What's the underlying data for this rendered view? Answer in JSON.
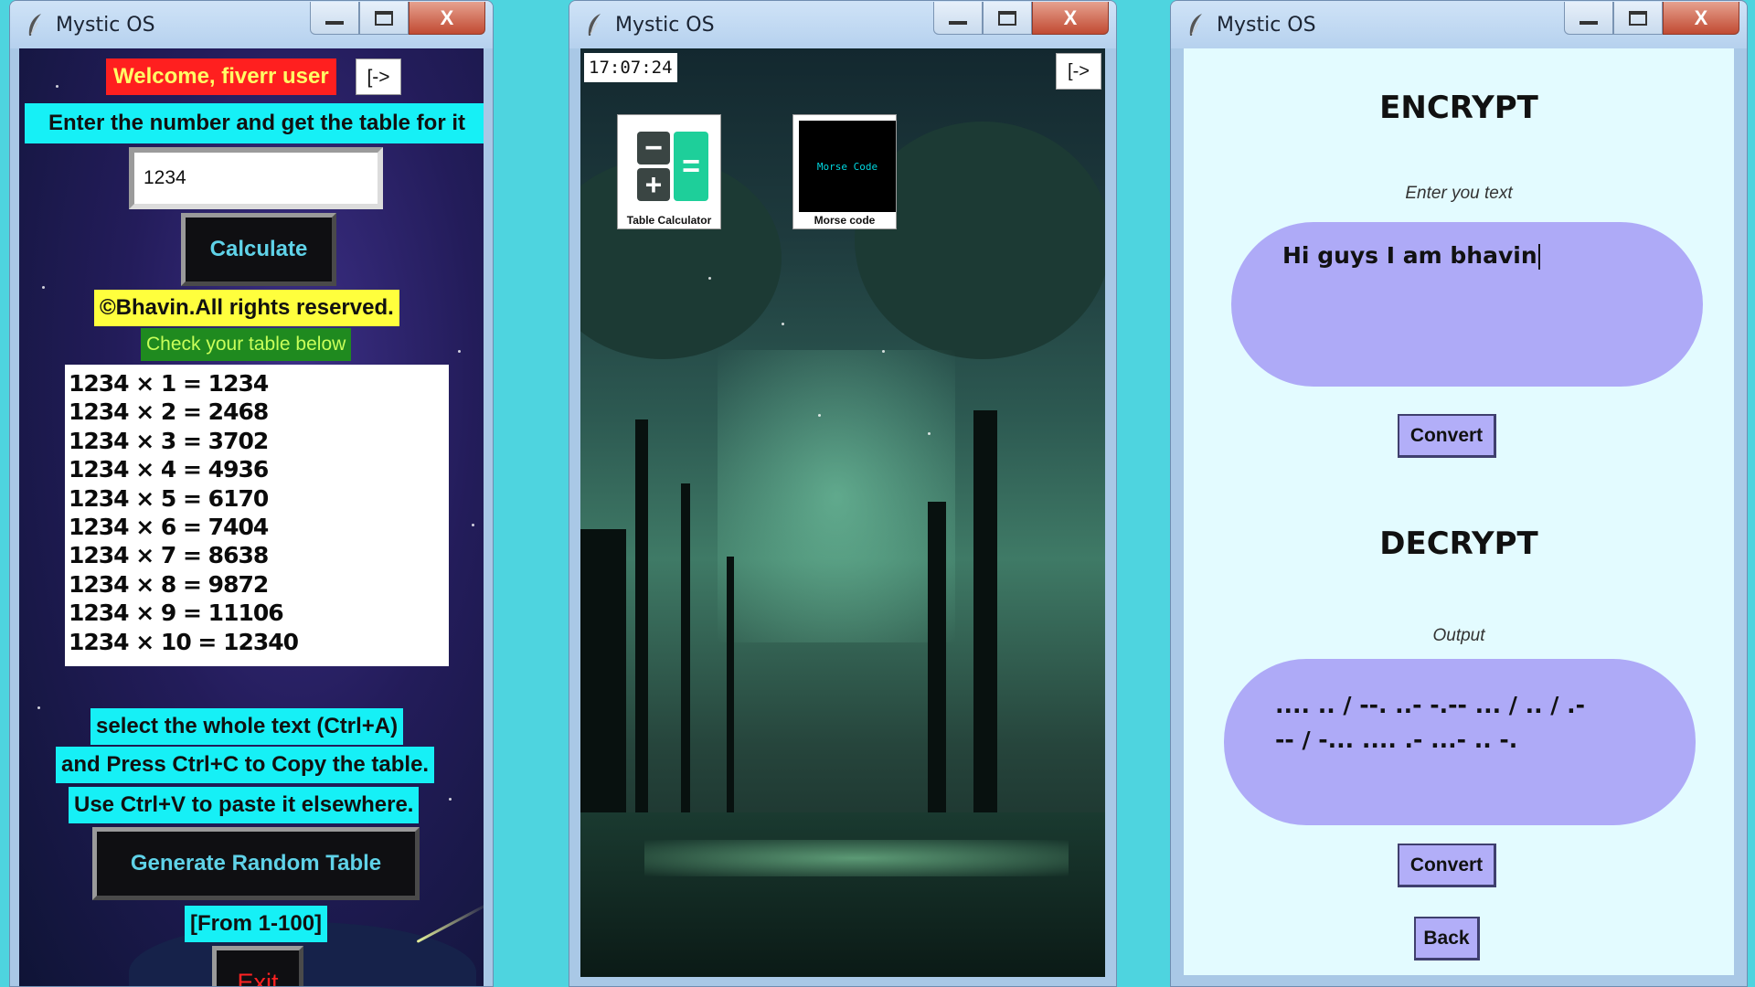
{
  "windows": [
    {
      "title": "Mystic OS",
      "welcome": "Welcome, fiverr user",
      "logout_label": "[->",
      "prompt": "Enter the number and get the table for it",
      "number_input": "1234",
      "calculate_label": "Calculate",
      "copyright": "©Bhavin.All rights reserved.",
      "check_label": "Check your table below",
      "table_rows": [
        "1234 × 1 = 1234",
        "1234 × 2 = 2468",
        "1234 × 3 = 3702",
        "1234 × 4 = 4936",
        "1234 × 5 = 6170",
        "1234 × 6 = 7404",
        "1234 × 7 = 8638",
        "1234 × 8 = 9872",
        "1234 × 9 = 11106",
        "1234 × 10 = 12340"
      ],
      "hint_lines": [
        "select the whole text (Ctrl+A)",
        "and Press Ctrl+C to Copy the table.",
        "Use Ctrl+V to paste it elsewhere."
      ],
      "random_label": "Generate Random Table",
      "range_label": "[From 1-100]",
      "exit_label": "Exit"
    },
    {
      "title": "Mystic OS",
      "clock": "17:07:24",
      "logout_label": "[->",
      "apps": [
        {
          "name": "Table Calculator",
          "icon": "calculator-icon"
        },
        {
          "name": "Morse code",
          "icon": "morse-code-icon",
          "icon_text": "Morse Code"
        }
      ]
    },
    {
      "title": "Mystic OS",
      "encrypt_title": "ENCRYPT",
      "encrypt_caption": "Enter you text",
      "encrypt_input": "Hi guys I am bhavin",
      "convert_label": "Convert",
      "decrypt_title": "DECRYPT",
      "output_caption": "Output",
      "output_lines": [
        ".... .. / --. ..- -.-- ... / .. / .-",
        "-- / -... .... .- ...- .. -."
      ],
      "back_label": "Back"
    }
  ],
  "colors": {
    "desktop": "#4ed4df",
    "welcome_bg": "#ff1f1f",
    "welcome_fg": "#ffff66",
    "cyan_label": "#16f0f6",
    "yellow_label": "#ffff3d",
    "green_label": "#1f8a1f",
    "green_label_fg": "#c8ff5a",
    "exit_fg": "#ff2222",
    "pill": "#aeaaf7",
    "panel_bg": "#e3fbff"
  },
  "icons": {
    "app": "feather-icon",
    "minimize": "minimize-icon",
    "maximize": "maximize-icon",
    "close": "close-icon"
  }
}
